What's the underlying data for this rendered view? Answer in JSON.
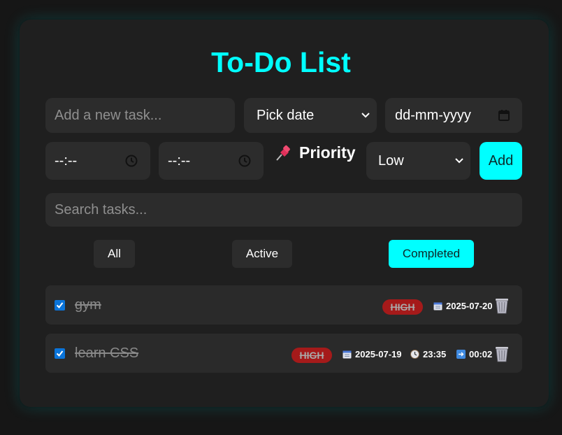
{
  "app": {
    "title": "To-Do List"
  },
  "form": {
    "task_placeholder": "Add a new task...",
    "date_select_value": "Pick date",
    "date_input_value": "dd-mm-yyyy",
    "start_time_value": "--:--",
    "end_time_value": "--:--",
    "priority_label": "Priority",
    "priority_value": "Low",
    "add_label": "Add"
  },
  "search": {
    "placeholder": "Search tasks..."
  },
  "filters": [
    {
      "label": "All",
      "selected": false
    },
    {
      "label": "Active",
      "selected": false
    },
    {
      "label": "Completed",
      "selected": true
    }
  ],
  "tasks": [
    {
      "text": "gym",
      "completed": true,
      "priority": "HIGH",
      "date": "2025-07-20"
    },
    {
      "text": "learn CSS",
      "completed": true,
      "priority": "HIGH",
      "date": "2025-07-19",
      "time": "23:35",
      "duration": "00:02"
    }
  ],
  "colors": {
    "accent": "#00ffff",
    "high_priority": "#a51a1a",
    "card": "#1f1f1f",
    "input": "#2c2c2c"
  },
  "icons": [
    "chevron-down-icon",
    "calendar-icon",
    "clock-icon",
    "pushpin-icon",
    "checkmark-icon",
    "wastebasket-icon",
    "arrow-right-icon"
  ]
}
